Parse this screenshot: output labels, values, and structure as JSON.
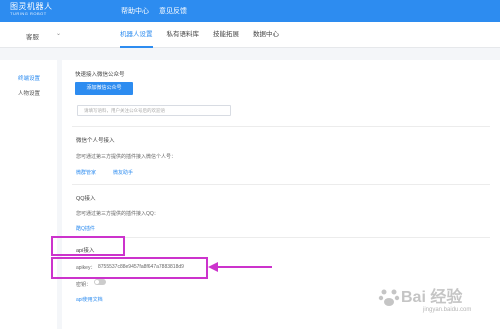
{
  "header": {
    "logo_main": "图灵机器人",
    "logo_sub": "TURING ROBOT",
    "nav": [
      "帮助中心",
      "意见反馈"
    ]
  },
  "subnav": {
    "bot_name": "客服",
    "tabs": [
      "机器人设置",
      "私有语料库",
      "技能拓展",
      "数据中心"
    ],
    "active_tab": "机器人设置"
  },
  "sidebar": {
    "items": [
      "终端设置",
      "人物设置"
    ],
    "active": "终端设置"
  },
  "sections": {
    "wechat_mp": {
      "title": "快速接入微信公众号",
      "button": "添加微信公众号",
      "input_placeholder": "请填写语料，用户关注公众号后的欢迎语"
    },
    "wechat_personal": {
      "title": "微信个人号接入",
      "desc": "您可通过第三方提供的插件接入微信个人号：",
      "links": [
        "微群管家",
        "微友助手"
      ]
    },
    "qq": {
      "title": "QQ接入",
      "desc": "您可通过第三方提供的插件接入QQ：",
      "link": "酷Q插件"
    },
    "api": {
      "title": "api接入",
      "apikey_label": "apikey：",
      "apikey_value": "8755537c88e9457fa8f647a7883818d9",
      "secret_label": "密钥：",
      "secret_enabled": false,
      "doc_link": "api使用文档"
    }
  },
  "watermark": {
    "text": "Bai 经验",
    "url": "jingyan.baidu.com"
  },
  "colors": {
    "primary": "#2d8cf0",
    "annotation": "#cc33cc"
  }
}
